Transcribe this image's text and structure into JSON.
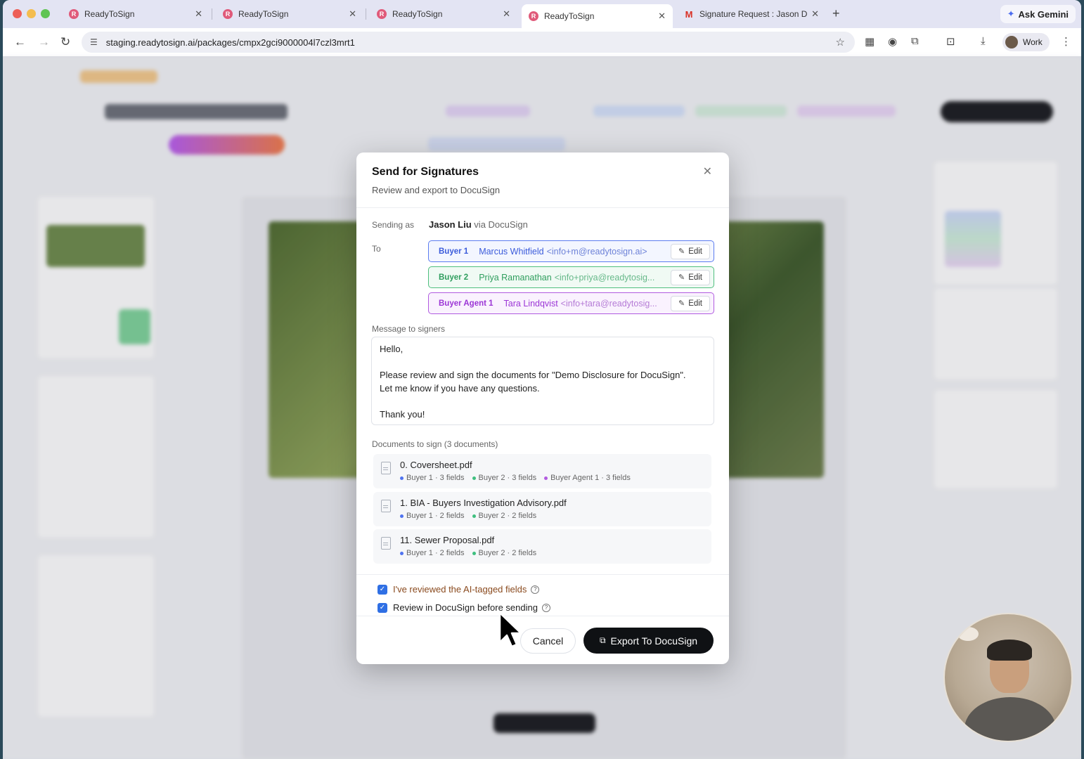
{
  "browser": {
    "tabs": [
      {
        "label": "ReadyToSign",
        "active": false,
        "icon": "readytosign-favicon"
      },
      {
        "label": "ReadyToSign",
        "active": false,
        "icon": "readytosign-favicon"
      },
      {
        "label": "ReadyToSign",
        "active": false,
        "icon": "readytosign-favicon"
      },
      {
        "label": "ReadyToSign",
        "active": true,
        "icon": "readytosign-favicon"
      },
      {
        "label": "Signature Request : Jason De",
        "active": false,
        "icon": "gmail-favicon"
      }
    ],
    "gemini_label": "Ask Gemini",
    "url": "staging.readytosign.ai/packages/cmpx2gci9000004l7czl3mrt1",
    "profile_label": "Work"
  },
  "modal": {
    "title": "Send for Signatures",
    "subtitle": "Review and export to DocuSign",
    "sending_as_label": "Sending as",
    "sender_name": "Jason Liu",
    "sender_via": " via DocuSign",
    "to_label": "To",
    "recipients": [
      {
        "role": "Buyer 1",
        "name": "Marcus Whitfield",
        "email": "<info+m@readytosign.ai>",
        "edit_label": "Edit",
        "color": "#3b5bdb"
      },
      {
        "role": "Buyer 2",
        "name": "Priya Ramanathan",
        "email": "<info+priya@readytosig...",
        "edit_label": "Edit",
        "color": "#2f9e5e"
      },
      {
        "role": "Buyer Agent 1",
        "name": "Tara Lindqvist",
        "email": "<info+tara@readytosig...",
        "edit_label": "Edit",
        "color": "#9c36d6"
      }
    ],
    "message_label": "Message to signers",
    "message_lines": [
      "Hello,",
      "",
      "Please review and sign the documents for \"Demo Disclosure for DocuSign\".",
      "Let me know if you have any questions.",
      "",
      "Thank you!"
    ],
    "documents_label": "Documents to sign (3 documents)",
    "documents": [
      {
        "name": "0. Coversheet.pdf",
        "tags": [
          {
            "label": "Buyer 1 · 3 fields",
            "color": "blue"
          },
          {
            "label": "Buyer 2 · 3 fields",
            "color": "green"
          },
          {
            "label": "Buyer Agent 1 · 3 fields",
            "color": "purple"
          }
        ]
      },
      {
        "name": "1. BIA - Buyers Investigation Advisory.pdf",
        "tags": [
          {
            "label": "Buyer 1 · 2 fields",
            "color": "blue"
          },
          {
            "label": "Buyer 2 · 2 fields",
            "color": "green"
          }
        ]
      },
      {
        "name": "11. Sewer Proposal.pdf",
        "tags": [
          {
            "label": "Buyer 1 · 2 fields",
            "color": "blue"
          },
          {
            "label": "Buyer 2 · 2 fields",
            "color": "green"
          }
        ]
      }
    ],
    "checkboxes": [
      {
        "label": "I've reviewed the AI-tagged fields",
        "checked": true
      },
      {
        "label": "Review in DocuSign before sending",
        "checked": true
      }
    ],
    "cancel_label": "Cancel",
    "export_label": "Export To DocuSign"
  }
}
